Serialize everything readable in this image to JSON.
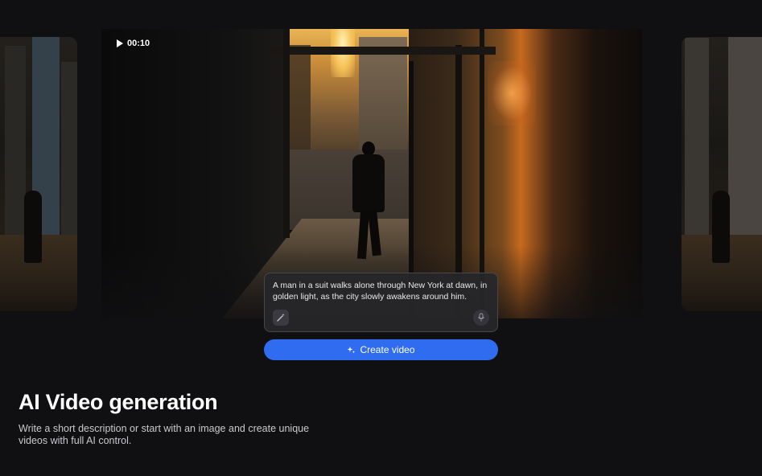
{
  "video": {
    "duration": "00:10",
    "play_icon": "play-icon"
  },
  "prompt": {
    "text": "A man in a suit walks alone through New York at dawn, in golden light, as the city slowly awakens around him.",
    "wand_icon": "magic-wand-icon",
    "mic_icon": "microphone-icon"
  },
  "create_button": {
    "label": "Create video",
    "icon": "sparkle-icon",
    "color": "#2f6cf0"
  },
  "hero": {
    "title": "AI Video generation",
    "description": "Write a short description or start with an image and create unique videos with full AI control."
  }
}
